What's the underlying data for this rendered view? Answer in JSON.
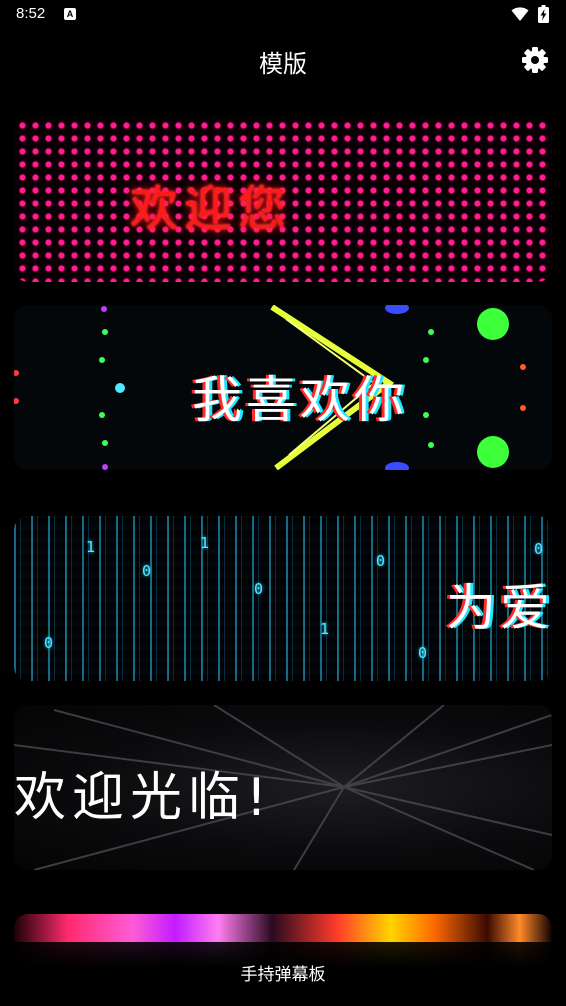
{
  "status_bar": {
    "time": "8:52",
    "app_icon_letter": "A",
    "wifi_icon": "wifi-icon",
    "battery_icon": "battery-charging-icon"
  },
  "app_bar": {
    "title": "模版",
    "settings_icon": "gear-icon"
  },
  "templates": [
    {
      "text": "欢迎您",
      "style": "led-dot-matrix",
      "accent": "#ff1f8e",
      "text_color": "#ff1a1a"
    },
    {
      "text": "我喜欢你",
      "style": "neon-glitch",
      "accent": "#7dff3a",
      "text_color": "#ffffff"
    },
    {
      "text": "为爱",
      "style": "matrix-rain",
      "accent": "#3fd8ff",
      "text_color": "#ffffff"
    },
    {
      "text": "欢迎光临!",
      "style": "tunnel",
      "accent": "#1e1e22",
      "text_color": "#ffffff"
    },
    {
      "text": "",
      "style": "colorful-swirl",
      "accent": "#ff5bd6",
      "text_color": "#ffffff"
    }
  ],
  "bottom_bar": {
    "label": "手持弹幕板"
  }
}
